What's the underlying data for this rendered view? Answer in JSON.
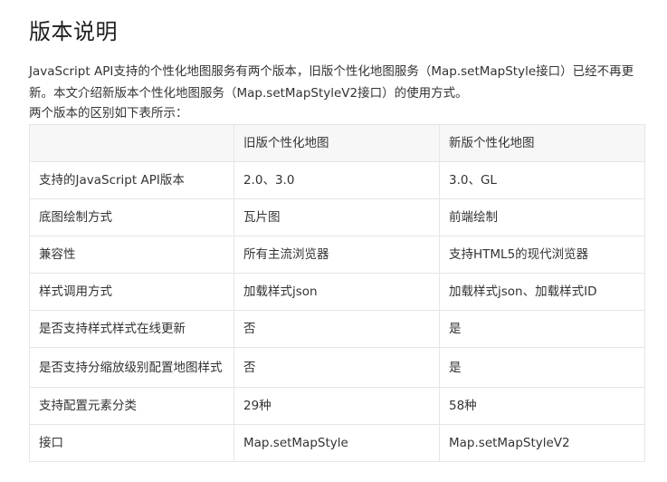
{
  "title": "版本说明",
  "intro_paragraph": "JavaScript API支持的个性化地图服务有两个版本，旧版个性化地图服务（Map.setMapStyle接口）已经不再更新。本文介绍新版本个性化地图服务（Map.setMapStyleV2接口）的使用方式。",
  "table_caption": "两个版本的区别如下表所示：",
  "table": {
    "headers": [
      "",
      "旧版个性化地图",
      "新版个性化地图"
    ],
    "rows": [
      [
        "支持的JavaScript API版本",
        "2.0、3.0",
        "3.0、GL"
      ],
      [
        "底图绘制方式",
        "瓦片图",
        "前端绘制"
      ],
      [
        "兼容性",
        "所有主流浏览器",
        "支持HTML5的现代浏览器"
      ],
      [
        "样式调用方式",
        "加载样式json",
        "加载样式json、加载样式ID"
      ],
      [
        "是否支持样式样式在线更新",
        "否",
        "是"
      ],
      [
        "是否支持分缩放级别配置地图样式",
        "否",
        "是"
      ],
      [
        "支持配置元素分类",
        "29种",
        "58种"
      ],
      [
        "接口",
        "Map.setMapStyle",
        "Map.setMapStyleV2"
      ]
    ]
  }
}
